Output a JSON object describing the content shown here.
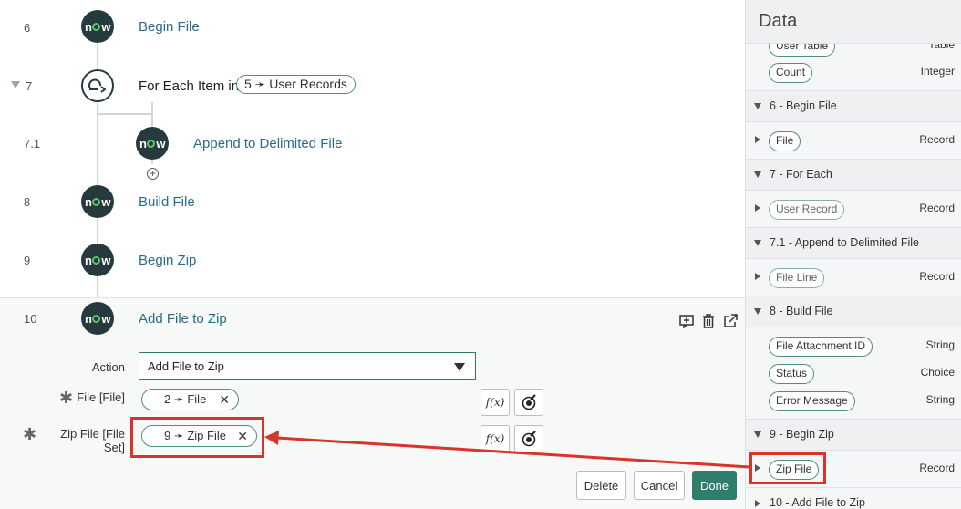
{
  "flow": {
    "steps": [
      {
        "num": "6",
        "title": "Begin File",
        "icon": "now-icon"
      },
      {
        "num": "7",
        "title": "For Each Item in",
        "pill": "5 ➛ User Records",
        "icon": "loop-icon"
      },
      {
        "num": "7.1",
        "title": "Append to Delimited File",
        "icon": "now-icon"
      },
      {
        "num": "8",
        "title": "Build File",
        "icon": "now-icon"
      },
      {
        "num": "9",
        "title": "Begin Zip",
        "icon": "now-icon"
      },
      {
        "num": "10",
        "title": "Add File to Zip",
        "icon": "now-icon"
      }
    ],
    "now_text": {
      "n": "n",
      "w": "w"
    },
    "add_glyph": "+"
  },
  "form": {
    "action_label": "Action",
    "action_value": "Add File to Zip",
    "file_label": "File [File]",
    "file_pill": "2 ➛ File",
    "zip_label": "Zip File [File Set]",
    "zip_pill": "9 ➛ Zip File",
    "required_mark": "✱",
    "remove_glyph": "✕",
    "fx_label": "f(x)"
  },
  "buttons": {
    "delete": "Delete",
    "cancel": "Cancel",
    "done": "Done"
  },
  "data_panel": {
    "title": "Data",
    "top_rows": [
      {
        "label": "User Table",
        "type": "Table"
      },
      {
        "label": "Count",
        "type": "Integer"
      }
    ],
    "sections": [
      {
        "title": "6 - Begin File",
        "rows": [
          {
            "label": "File",
            "type": "Record"
          }
        ]
      },
      {
        "title": "7 - For Each",
        "rows": [
          {
            "label": "User Record",
            "type": "Record"
          }
        ]
      },
      {
        "title": "7.1 - Append to Delimited File",
        "rows": [
          {
            "label": "File Line",
            "type": "Record"
          }
        ]
      },
      {
        "title": "8 - Build File",
        "rows": [
          {
            "label": "File Attachment ID",
            "type": "String"
          },
          {
            "label": "Status",
            "type": "Choice"
          },
          {
            "label": "Error Message",
            "type": "String"
          }
        ]
      },
      {
        "title": "9 - Begin Zip",
        "rows": [
          {
            "label": "Zip File",
            "type": "Record"
          }
        ]
      },
      {
        "title": "10 - Add File to Zip",
        "rows": []
      }
    ]
  },
  "colors": {
    "accent": "#2f7d6b",
    "annotation": "#d9332b",
    "icon_bg": "#263a3d",
    "link": "#2a6b8a"
  }
}
